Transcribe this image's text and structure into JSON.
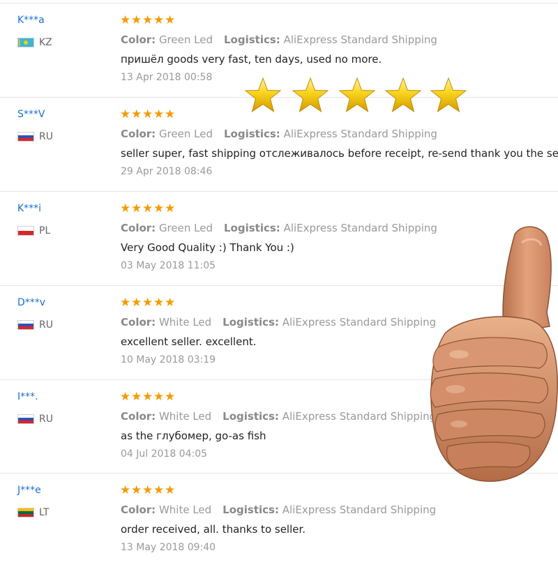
{
  "labels": {
    "color": "Color:",
    "logistics": "Logistics:"
  },
  "colors": {
    "user_link": "#1a6fd1",
    "star": "#f59b00",
    "meta_text": "#999999"
  },
  "reviews": [
    {
      "user": "K***a",
      "country": "KZ",
      "flag": "kazakhstan-flag-icon",
      "stars": 5,
      "color": "Green Led",
      "logistics": "AliExpress Standard Shipping",
      "text": "пришёл goods very fast, ten days, used no more.",
      "date": "13 Apr 2018 00:58"
    },
    {
      "user": "S***V",
      "country": "RU",
      "flag": "russia-flag-icon",
      "stars": 5,
      "color": "Green Led",
      "logistics": "AliExpress Standard Shipping",
      "text": "seller super, fast shipping отслеживалось before receipt, re-send thank you the seller r",
      "date": "29 Apr 2018 08:46"
    },
    {
      "user": "K***i",
      "country": "PL",
      "flag": "poland-flag-icon",
      "stars": 5,
      "color": "Green Led",
      "logistics": "AliExpress Standard Shipping",
      "text": "Very Good Quality :) Thank You :)",
      "date": "03 May 2018 11:05"
    },
    {
      "user": "D***v",
      "country": "RU",
      "flag": "russia-flag-icon",
      "stars": 5,
      "color": "White Led",
      "logistics": "AliExpress Standard Shipping",
      "text": "excellent seller. excellent.",
      "date": "10 May 2018 03:19"
    },
    {
      "user": "I***.",
      "country": "RU",
      "flag": "russia-flag-icon",
      "stars": 5,
      "color": "White Led",
      "logistics": "AliExpress Standard Shipping",
      "text": "as the глубомер, go-as fish",
      "date": "04 Jul 2018 04:05"
    },
    {
      "user": "J***e",
      "country": "LT",
      "flag": "lithuania-flag-icon",
      "stars": 5,
      "color": "White Led",
      "logistics": "AliExpress Standard Shipping",
      "text": "order received, all. thanks to seller.",
      "date": "13 May 2018 09:40"
    }
  ],
  "decorations": {
    "overlay_stars": {
      "count": 5,
      "icon": "gold-star-icon",
      "color": "#f7d31c"
    },
    "thumb": {
      "icon": "thumbs-up-hand-icon"
    }
  }
}
